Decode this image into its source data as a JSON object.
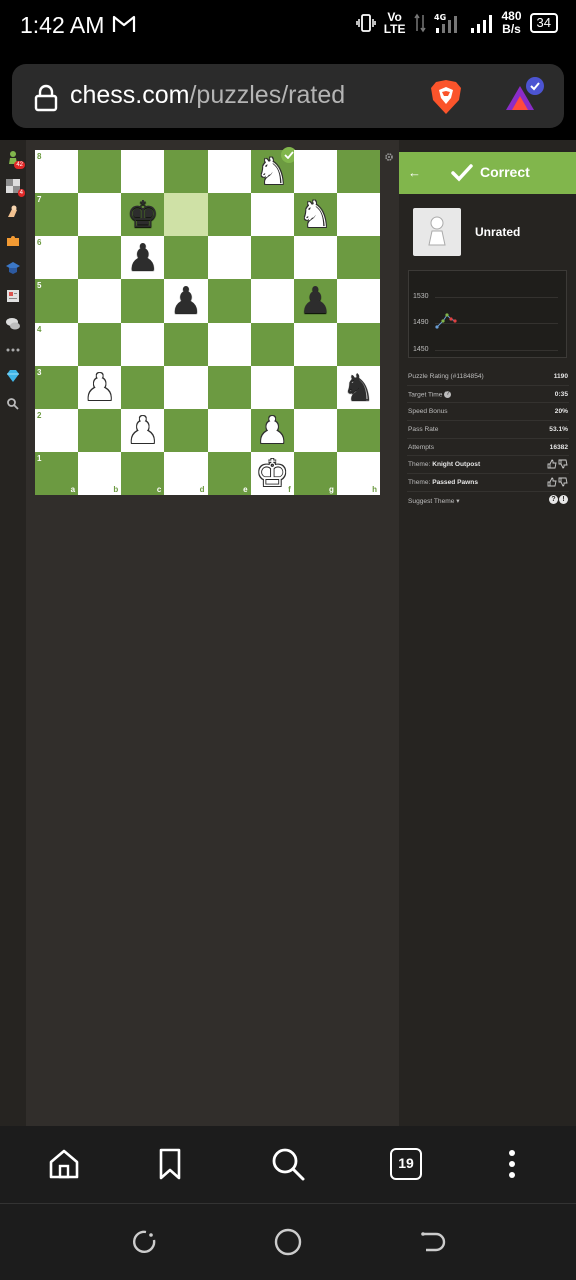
{
  "status_bar": {
    "time": "1:42 AM",
    "volte_top": "Vo",
    "volte_bottom": "LTE",
    "network_type": "4G",
    "speed_value": "480",
    "speed_unit": "B/s",
    "battery": "34"
  },
  "browser": {
    "url_domain": "chess.com",
    "url_path": "/puzzles/rated",
    "tab_count": "19"
  },
  "board": {
    "ranks": [
      "8",
      "7",
      "6",
      "5",
      "4",
      "3",
      "2",
      "1"
    ],
    "files": [
      "a",
      "b",
      "c",
      "d",
      "e",
      "f",
      "g",
      "h"
    ],
    "highlight": [
      "d7"
    ],
    "pieces": {
      "f8": {
        "glyph": "♞",
        "color": "w"
      },
      "c7": {
        "glyph": "♚",
        "color": "b"
      },
      "g7": {
        "glyph": "♞",
        "color": "w"
      },
      "c6": {
        "glyph": "♟",
        "color": "b"
      },
      "d5": {
        "glyph": "♟",
        "color": "b"
      },
      "g5": {
        "glyph": "♟",
        "color": "b"
      },
      "b3": {
        "glyph": "♟",
        "color": "w"
      },
      "h3": {
        "glyph": "♞",
        "color": "b"
      },
      "c2": {
        "glyph": "♟",
        "color": "w"
      },
      "f2": {
        "glyph": "♟",
        "color": "w"
      },
      "f1": {
        "glyph": "♚",
        "color": "w"
      }
    },
    "correct_square": "f8"
  },
  "panel": {
    "back_label": "←",
    "status_label": "Correct",
    "mode_label": "Unrated",
    "graph_ticks": [
      "1530",
      "1490",
      "1450"
    ],
    "stats": [
      {
        "key": "Puzzle Rating (#1184854)",
        "value": "1190"
      },
      {
        "key": "Target Time",
        "value": "0:35",
        "help": "?"
      },
      {
        "key": "Speed Bonus",
        "value": "20%"
      },
      {
        "key": "Pass Rate",
        "value": "53.1%"
      },
      {
        "key": "Attempts",
        "value": "16382"
      }
    ],
    "themes": [
      {
        "prefix": "Theme: ",
        "name": "Knight Outpost"
      },
      {
        "prefix": "Theme: ",
        "name": "Passed Pawns"
      }
    ],
    "suggest_label": "Suggest Theme",
    "suggest_icons": [
      "?",
      "!"
    ]
  },
  "sidenav_badges": {
    "puzzles": "42",
    "learn": "4"
  },
  "colors": {
    "board_dark": "#6c9a41",
    "board_light": "#ffffff",
    "accent_green": "#81b64c",
    "page_bg": "#312e2b",
    "panel_bg": "#262421"
  }
}
